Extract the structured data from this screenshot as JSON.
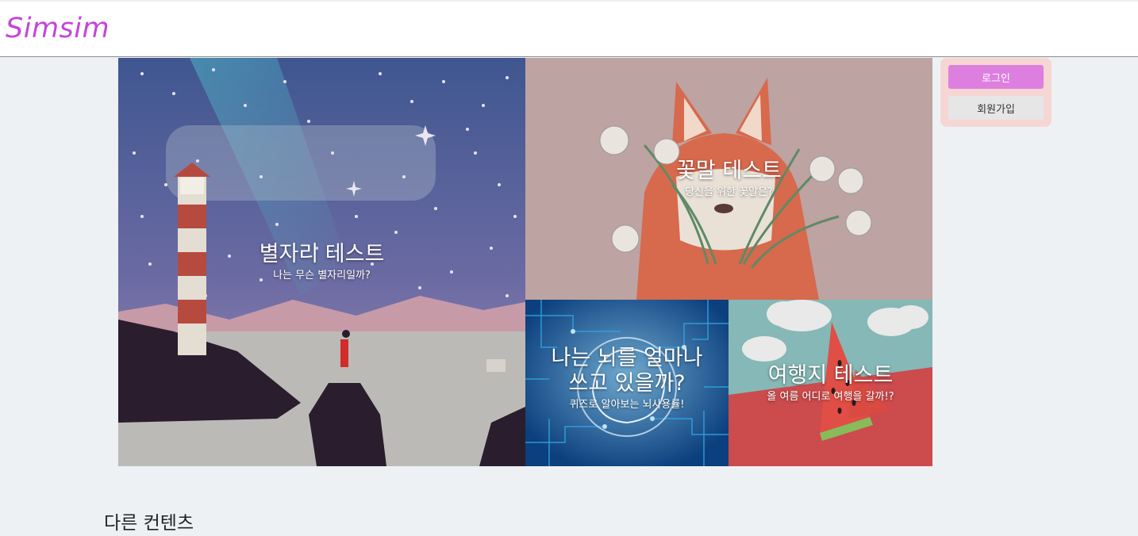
{
  "header": {
    "logo": "Simsim"
  },
  "tiles": [
    {
      "title": "별자리 테스트",
      "subtitle": "나는 무슨 별자리일까?"
    },
    {
      "title": "꽃말 테스트",
      "subtitle": "당신을 위한 꽃말은?"
    },
    {
      "title_line1": "나는 뇌를 얼마나",
      "title_line2": "쓰고 있을까?",
      "subtitle": "퀴즈로 알아보는 뇌사용률!"
    },
    {
      "title": "여행지 테스트",
      "subtitle": "올 여름 어디로 여행을 갈까!?"
    }
  ],
  "auth": {
    "login_label": "로그인",
    "signup_label": "회원가입"
  },
  "section": {
    "other_title": "다른 컨텐츠"
  },
  "colors": {
    "brand": "#c744dc",
    "login_button": "#dd7fdf",
    "auth_panel": "#f5d6d3"
  }
}
